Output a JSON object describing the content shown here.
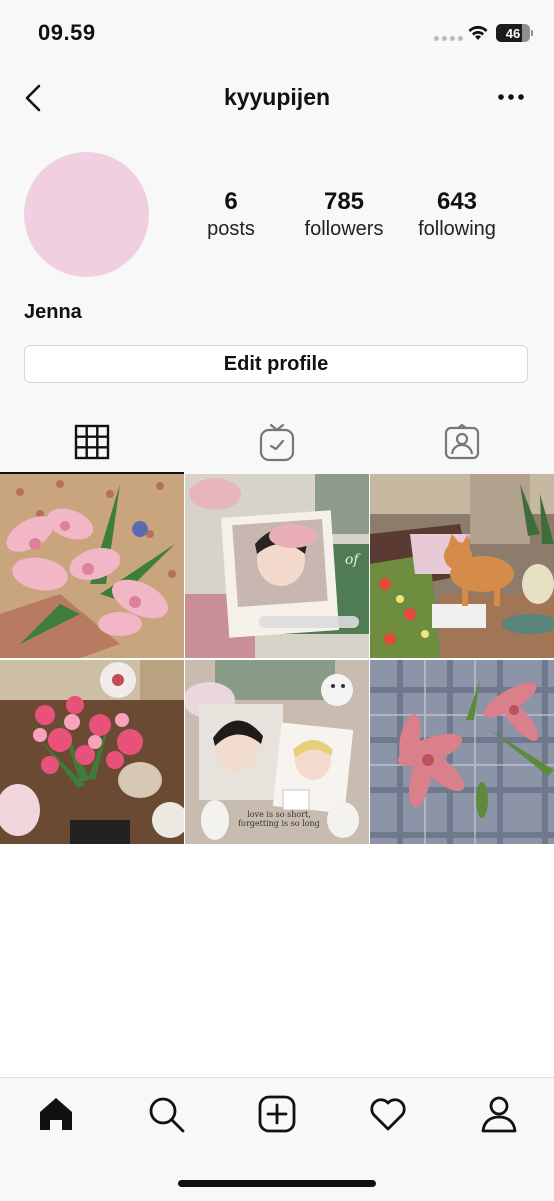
{
  "status_bar": {
    "time": "09.59",
    "battery": "46"
  },
  "header": {
    "username": "kyyupijen",
    "back_icon": "chevron-left-icon",
    "more_icon": "more-horizontal-icon"
  },
  "profile": {
    "avatar_color": "#f2cfe0",
    "stats": [
      {
        "value": "6",
        "label": "posts"
      },
      {
        "value": "785",
        "label": "followers"
      },
      {
        "value": "643",
        "label": "following"
      }
    ],
    "display_name": "Jenna",
    "edit_button": "Edit profile"
  },
  "tabs": [
    {
      "name": "grid",
      "icon": "grid-icon",
      "active": true
    },
    {
      "name": "igtv",
      "icon": "tv-icon",
      "active": false
    },
    {
      "name": "tagged",
      "icon": "tagged-person-icon",
      "active": false
    }
  ],
  "posts": [
    {
      "desc": "bouquet of pink lilies"
    },
    {
      "desc": "polaroid collage edit"
    },
    {
      "desc": "cat figurine on table"
    },
    {
      "desc": "pink carnations bouquet"
    },
    {
      "desc": "scrapbook collage edit"
    },
    {
      "desc": "pink lily on plaid fabric"
    }
  ],
  "post_texts": {
    "collage_caption_1": "love is so short,",
    "collage_caption_2": "forgetting is so long"
  },
  "bottom_nav": [
    {
      "icon": "home-icon",
      "active": true
    },
    {
      "icon": "search-icon",
      "active": false
    },
    {
      "icon": "add-post-icon",
      "active": false
    },
    {
      "icon": "heart-icon",
      "active": false
    },
    {
      "icon": "profile-icon",
      "active": false
    }
  ],
  "colors": {
    "background": "#f8f8f8",
    "text": "#111111",
    "border": "#d7d7d7"
  }
}
